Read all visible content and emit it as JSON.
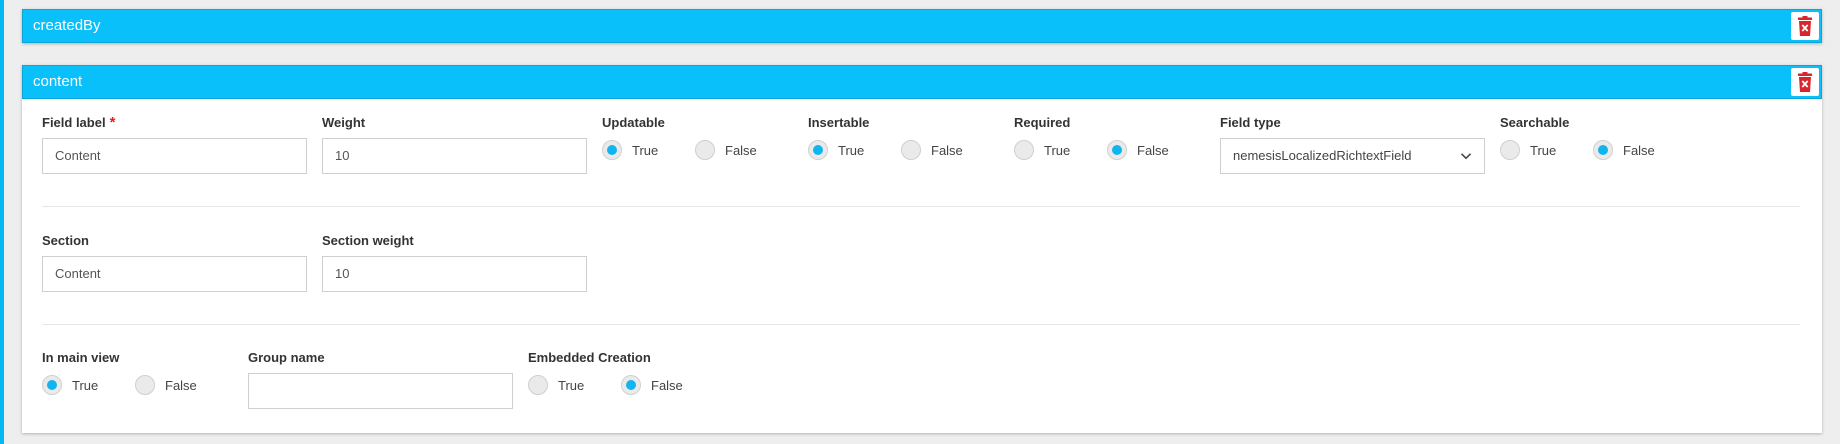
{
  "panels": [
    {
      "title": "createdBy"
    },
    {
      "title": "content"
    }
  ],
  "fields": {
    "field_label": {
      "label": "Field label",
      "required_mark": "*",
      "value": "Content"
    },
    "weight": {
      "label": "Weight",
      "value": "10"
    },
    "updatable": {
      "label": "Updatable",
      "selected": "True"
    },
    "insertable": {
      "label": "Insertable",
      "selected": "True"
    },
    "required": {
      "label": "Required",
      "selected": "False"
    },
    "field_type": {
      "label": "Field type",
      "value": "nemesisLocalizedRichtextField"
    },
    "searchable": {
      "label": "Searchable",
      "selected": "False"
    },
    "section": {
      "label": "Section",
      "value": "Content"
    },
    "section_weight": {
      "label": "Section weight",
      "value": "10"
    },
    "in_main_view": {
      "label": "In main view",
      "selected": "True"
    },
    "group_name": {
      "label": "Group name",
      "value": ""
    },
    "embedded_creation": {
      "label": "Embedded Creation",
      "selected": "False"
    }
  },
  "options": {
    "true_label": "True",
    "false_label": "False"
  },
  "icons": {
    "delete": "trash-delete-icon",
    "dropdown": "chevron-down-icon"
  },
  "colors": {
    "header": "#0ac0fb",
    "radio_selected": "#10b5f0",
    "delete_icon": "#d9262c",
    "required": "#e02020"
  }
}
